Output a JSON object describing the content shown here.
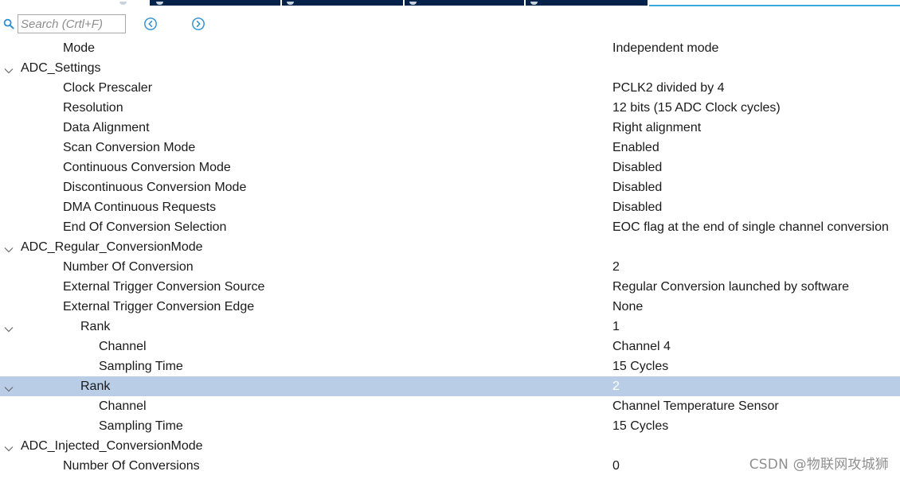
{
  "search": {
    "placeholder": "Search (Crtl+F)"
  },
  "tree": {
    "rows": [
      {
        "name": "Mode",
        "value": "Independent mode",
        "level": 1
      },
      {
        "name": "ADC_Settings",
        "value": "",
        "level": "group",
        "expanded": true
      },
      {
        "name": "Clock Prescaler",
        "value": "PCLK2 divided by 4",
        "level": 1
      },
      {
        "name": "Resolution",
        "value": "12 bits (15 ADC Clock cycles)",
        "level": 1
      },
      {
        "name": "Data Alignment",
        "value": "Right alignment",
        "level": 1
      },
      {
        "name": "Scan Conversion Mode",
        "value": "Enabled",
        "level": 1
      },
      {
        "name": "Continuous Conversion Mode",
        "value": "Disabled",
        "level": 1
      },
      {
        "name": "Discontinuous Conversion Mode",
        "value": "Disabled",
        "level": 1
      },
      {
        "name": "DMA Continuous Requests",
        "value": "Disabled",
        "level": 1
      },
      {
        "name": "End Of Conversion Selection",
        "value": "EOC flag at the end of single channel conversion",
        "level": 1
      },
      {
        "name": "ADC_Regular_ConversionMode",
        "value": "",
        "level": "group",
        "expanded": true
      },
      {
        "name": "Number Of Conversion",
        "value": "2",
        "level": 1
      },
      {
        "name": "External Trigger Conversion Source",
        "value": "Regular Conversion launched by software",
        "level": 1
      },
      {
        "name": "External Trigger Conversion Edge",
        "value": "None",
        "level": 1
      },
      {
        "name": "Rank",
        "value": "1",
        "level": "rank",
        "expanded": true
      },
      {
        "name": "Channel",
        "value": "Channel 4",
        "level": 2
      },
      {
        "name": "Sampling Time",
        "value": "15 Cycles",
        "level": 2
      },
      {
        "name": "Rank",
        "value": "2",
        "level": "rank",
        "expanded": true,
        "selected": true
      },
      {
        "name": "Channel",
        "value": "Channel Temperature Sensor",
        "level": 2
      },
      {
        "name": "Sampling Time",
        "value": "15 Cycles",
        "level": 2
      },
      {
        "name": "ADC_Injected_ConversionMode",
        "value": "",
        "level": "group",
        "expanded": true
      },
      {
        "name": "Number Of Conversions",
        "value": "0",
        "level": 1
      }
    ]
  },
  "watermark": "CSDN @物联网攻城狮",
  "colors": {
    "selected_row": "#b9cee6",
    "tab_strip": "#03234b",
    "accent_line": "#39a9dc",
    "nav_icon": "#2a8fd4"
  }
}
